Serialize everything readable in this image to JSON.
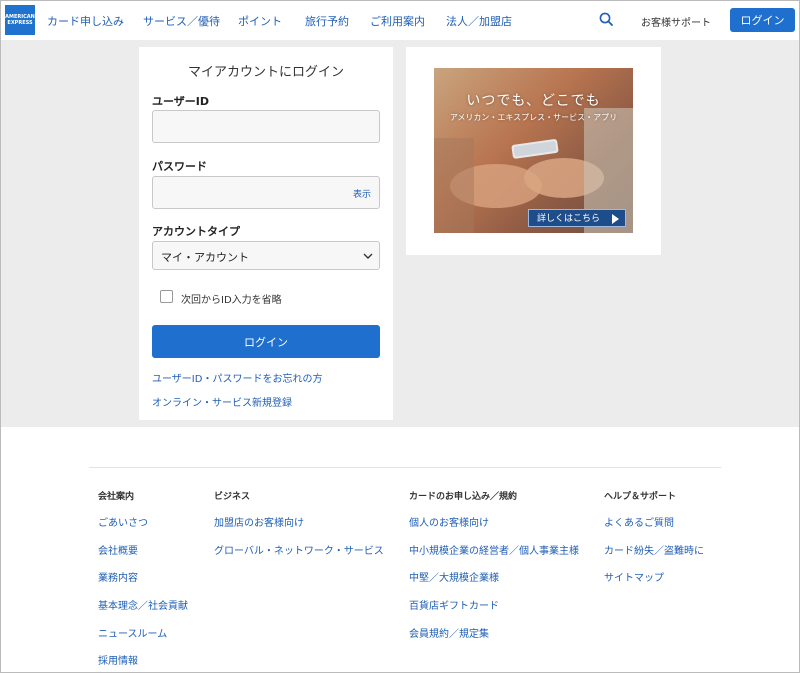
{
  "header": {
    "logo_lines": [
      "AMERICAN",
      "EXPRESS"
    ],
    "nav": [
      "カード申し込み",
      "サービス／優待",
      "ポイント",
      "旅行予約",
      "ご利用案内",
      "法人／加盟店"
    ],
    "support": "お客様サポート",
    "login": "ログイン"
  },
  "login": {
    "title": "マイアカウントにログイン",
    "userid_label": "ユーザーID",
    "password_label": "パスワード",
    "show": "表示",
    "account_type_label": "アカウントタイプ",
    "account_type_value": "マイ・アカウント",
    "remember": "次回からID入力を省略",
    "button": "ログイン",
    "forgot": "ユーザーID・パスワードをお忘れの方",
    "register": "オンライン・サービス新規登録"
  },
  "ad": {
    "headline": "いつでも、どこでも",
    "sub": "アメリカン・エキスプレス・サービス・アプリ",
    "button": "詳しくはこちら"
  },
  "footer": {
    "columns": [
      {
        "title": "会社案内",
        "links": [
          "ごあいさつ",
          "会社概要",
          "業務内容",
          "基本理念／社会貢献",
          "ニュースルーム",
          "採用情報"
        ]
      },
      {
        "title": "ビジネス",
        "links": [
          "加盟店のお客様向け",
          "グローバル・ネットワーク・サービス"
        ]
      },
      {
        "title": "カードのお申し込み／規約",
        "links": [
          "個人のお客様向け",
          "中小規模企業の経営者／個人事業主様",
          "中堅／大規模企業様",
          "百貨店ギフトカード",
          "会員規約／規定集"
        ]
      },
      {
        "title": "ヘルプ＆サポート",
        "links": [
          "よくあるご質問",
          "カード紛失／盗難時に",
          "サイトマップ"
        ]
      }
    ]
  },
  "colors": {
    "brand_blue": "#1f6fcf",
    "link_blue": "#1f5fb5",
    "background_gray": "#ececec"
  }
}
